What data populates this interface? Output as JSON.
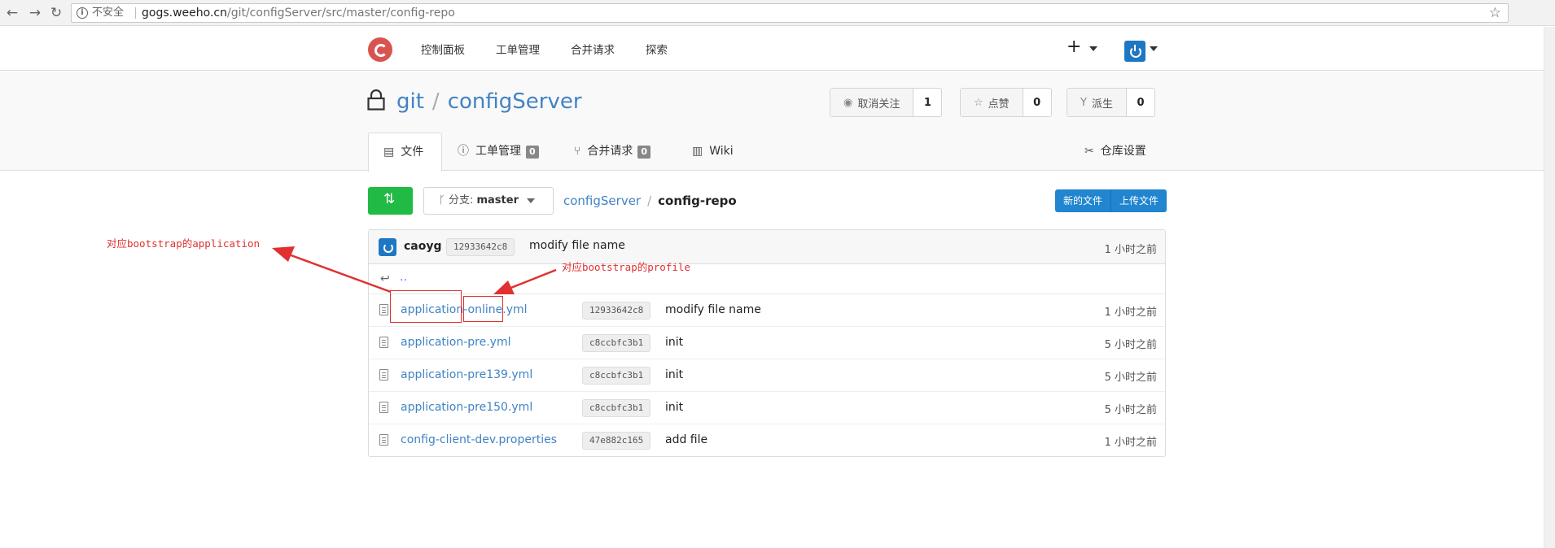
{
  "browser": {
    "insecure_label": "不安全",
    "url_host": "gogs.weeho.cn",
    "url_path": "/git/configServer/src/master/config-repo"
  },
  "header": {
    "nav": [
      "控制面板",
      "工单管理",
      "合并请求",
      "探索"
    ],
    "plus": "+"
  },
  "repo": {
    "owner": "git",
    "name": "configServer",
    "unwatch_label": "取消关注",
    "unwatch_count": "1",
    "star_label": "点赞",
    "star_count": "0",
    "fork_label": "派生",
    "fork_count": "0"
  },
  "tabs": {
    "files": "文件",
    "issues": "工单管理",
    "issues_count": "0",
    "pulls": "合并请求",
    "pulls_count": "0",
    "wiki": "Wiki",
    "settings": "仓库设置"
  },
  "toolbar": {
    "branch_prefix": "分支:",
    "branch": "master",
    "crumb_root": "configServer",
    "crumb_current": "config-repo",
    "new_file": "新的文件",
    "upload_file": "上传文件"
  },
  "commit": {
    "author": "caoyg",
    "sha": "12933642c8",
    "message": "modify file name",
    "age": "1 小时之前"
  },
  "parent_dir": "..",
  "files": [
    {
      "name": "application-online.yml",
      "sha": "12933642c8",
      "message": "modify file name",
      "age": "1 小时之前"
    },
    {
      "name": "application-pre.yml",
      "sha": "c8ccbfc3b1",
      "message": "init",
      "age": "5 小时之前"
    },
    {
      "name": "application-pre139.yml",
      "sha": "c8ccbfc3b1",
      "message": "init",
      "age": "5 小时之前"
    },
    {
      "name": "application-pre150.yml",
      "sha": "c8ccbfc3b1",
      "message": "init",
      "age": "5 小时之前"
    },
    {
      "name": "config-client-dev.properties",
      "sha": "47e882c165",
      "message": "add file",
      "age": "1 小时之前"
    }
  ],
  "annotations": {
    "application": "对应bootstrap的application",
    "profile": "对应bootstrap的profile"
  }
}
